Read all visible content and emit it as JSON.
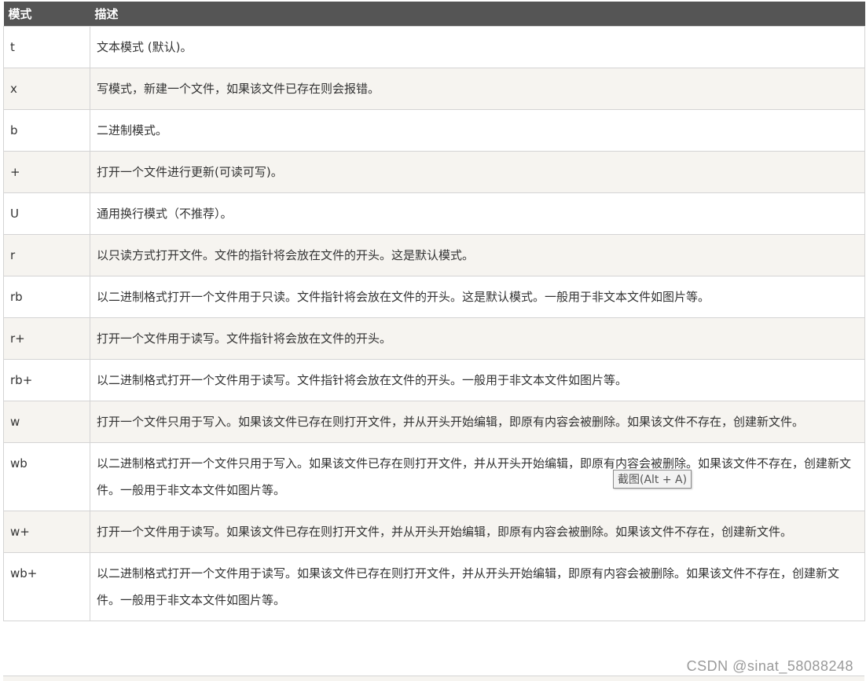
{
  "table": {
    "headers": {
      "mode": "模式",
      "description": "描述"
    },
    "rows": [
      {
        "mode": "t",
        "description": "文本模式 (默认)。"
      },
      {
        "mode": "x",
        "description": "写模式，新建一个文件，如果该文件已存在则会报错。"
      },
      {
        "mode": "b",
        "description": "二进制模式。"
      },
      {
        "mode": "+",
        "description": "打开一个文件进行更新(可读可写)。"
      },
      {
        "mode": "U",
        "description": "通用换行模式（不推荐）。"
      },
      {
        "mode": "r",
        "description": "以只读方式打开文件。文件的指针将会放在文件的开头。这是默认模式。"
      },
      {
        "mode": "rb",
        "description": "以二进制格式打开一个文件用于只读。文件指针将会放在文件的开头。这是默认模式。一般用于非文本文件如图片等。"
      },
      {
        "mode": "r+",
        "description": "打开一个文件用于读写。文件指针将会放在文件的开头。"
      },
      {
        "mode": "rb+",
        "description": "以二进制格式打开一个文件用于读写。文件指针将会放在文件的开头。一般用于非文本文件如图片等。"
      },
      {
        "mode": "w",
        "description": "打开一个文件只用于写入。如果该文件已存在则打开文件，并从开头开始编辑，即原有内容会被删除。如果该文件不存在，创建新文件。"
      },
      {
        "mode": "wb",
        "description": "以二进制格式打开一个文件只用于写入。如果该文件已存在则打开文件，并从开头开始编辑，即原有内容会被删除。如果该文件不存在，创建新文件。一般用于非文本文件如图片等。"
      },
      {
        "mode": "w+",
        "description": "打开一个文件用于读写。如果该文件已存在则打开文件，并从开头开始编辑，即原有内容会被删除。如果该文件不存在，创建新文件。"
      },
      {
        "mode": "wb+",
        "description": "以二进制格式打开一个文件用于读写。如果该文件已存在则打开文件，并从开头开始编辑，即原有内容会被删除。如果该文件不存在，创建新文件。一般用于非文本文件如图片等。"
      }
    ]
  },
  "tooltip": {
    "text": "截图(Alt + A)"
  },
  "watermark": {
    "text": "CSDN @sinat_58088248"
  }
}
